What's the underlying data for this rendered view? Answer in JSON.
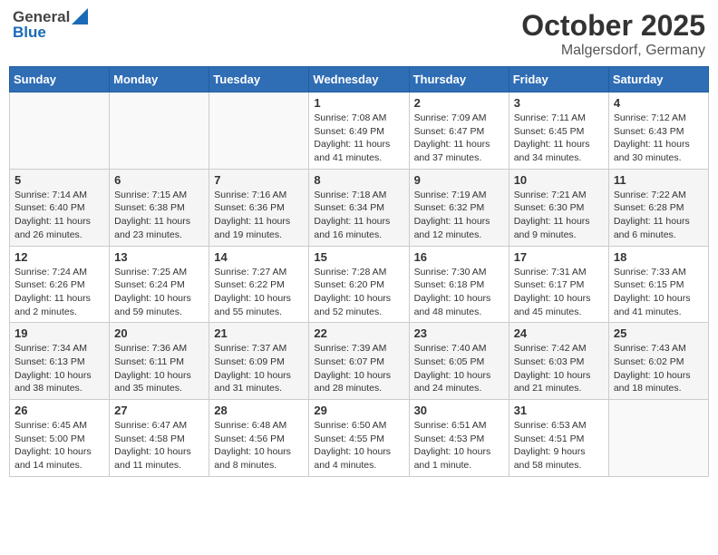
{
  "header": {
    "logo": {
      "general": "General",
      "blue": "Blue"
    },
    "month": "October 2025",
    "location": "Malgersdorf, Germany"
  },
  "weekdays": [
    "Sunday",
    "Monday",
    "Tuesday",
    "Wednesday",
    "Thursday",
    "Friday",
    "Saturday"
  ],
  "weeks": [
    [
      {
        "day": "",
        "sunrise": "",
        "sunset": "",
        "daylight": ""
      },
      {
        "day": "",
        "sunrise": "",
        "sunset": "",
        "daylight": ""
      },
      {
        "day": "",
        "sunrise": "",
        "sunset": "",
        "daylight": ""
      },
      {
        "day": "1",
        "sunrise": "Sunrise: 7:08 AM",
        "sunset": "Sunset: 6:49 PM",
        "daylight": "Daylight: 11 hours and 41 minutes."
      },
      {
        "day": "2",
        "sunrise": "Sunrise: 7:09 AM",
        "sunset": "Sunset: 6:47 PM",
        "daylight": "Daylight: 11 hours and 37 minutes."
      },
      {
        "day": "3",
        "sunrise": "Sunrise: 7:11 AM",
        "sunset": "Sunset: 6:45 PM",
        "daylight": "Daylight: 11 hours and 34 minutes."
      },
      {
        "day": "4",
        "sunrise": "Sunrise: 7:12 AM",
        "sunset": "Sunset: 6:43 PM",
        "daylight": "Daylight: 11 hours and 30 minutes."
      }
    ],
    [
      {
        "day": "5",
        "sunrise": "Sunrise: 7:14 AM",
        "sunset": "Sunset: 6:40 PM",
        "daylight": "Daylight: 11 hours and 26 minutes."
      },
      {
        "day": "6",
        "sunrise": "Sunrise: 7:15 AM",
        "sunset": "Sunset: 6:38 PM",
        "daylight": "Daylight: 11 hours and 23 minutes."
      },
      {
        "day": "7",
        "sunrise": "Sunrise: 7:16 AM",
        "sunset": "Sunset: 6:36 PM",
        "daylight": "Daylight: 11 hours and 19 minutes."
      },
      {
        "day": "8",
        "sunrise": "Sunrise: 7:18 AM",
        "sunset": "Sunset: 6:34 PM",
        "daylight": "Daylight: 11 hours and 16 minutes."
      },
      {
        "day": "9",
        "sunrise": "Sunrise: 7:19 AM",
        "sunset": "Sunset: 6:32 PM",
        "daylight": "Daylight: 11 hours and 12 minutes."
      },
      {
        "day": "10",
        "sunrise": "Sunrise: 7:21 AM",
        "sunset": "Sunset: 6:30 PM",
        "daylight": "Daylight: 11 hours and 9 minutes."
      },
      {
        "day": "11",
        "sunrise": "Sunrise: 7:22 AM",
        "sunset": "Sunset: 6:28 PM",
        "daylight": "Daylight: 11 hours and 6 minutes."
      }
    ],
    [
      {
        "day": "12",
        "sunrise": "Sunrise: 7:24 AM",
        "sunset": "Sunset: 6:26 PM",
        "daylight": "Daylight: 11 hours and 2 minutes."
      },
      {
        "day": "13",
        "sunrise": "Sunrise: 7:25 AM",
        "sunset": "Sunset: 6:24 PM",
        "daylight": "Daylight: 10 hours and 59 minutes."
      },
      {
        "day": "14",
        "sunrise": "Sunrise: 7:27 AM",
        "sunset": "Sunset: 6:22 PM",
        "daylight": "Daylight: 10 hours and 55 minutes."
      },
      {
        "day": "15",
        "sunrise": "Sunrise: 7:28 AM",
        "sunset": "Sunset: 6:20 PM",
        "daylight": "Daylight: 10 hours and 52 minutes."
      },
      {
        "day": "16",
        "sunrise": "Sunrise: 7:30 AM",
        "sunset": "Sunset: 6:18 PM",
        "daylight": "Daylight: 10 hours and 48 minutes."
      },
      {
        "day": "17",
        "sunrise": "Sunrise: 7:31 AM",
        "sunset": "Sunset: 6:17 PM",
        "daylight": "Daylight: 10 hours and 45 minutes."
      },
      {
        "day": "18",
        "sunrise": "Sunrise: 7:33 AM",
        "sunset": "Sunset: 6:15 PM",
        "daylight": "Daylight: 10 hours and 41 minutes."
      }
    ],
    [
      {
        "day": "19",
        "sunrise": "Sunrise: 7:34 AM",
        "sunset": "Sunset: 6:13 PM",
        "daylight": "Daylight: 10 hours and 38 minutes."
      },
      {
        "day": "20",
        "sunrise": "Sunrise: 7:36 AM",
        "sunset": "Sunset: 6:11 PM",
        "daylight": "Daylight: 10 hours and 35 minutes."
      },
      {
        "day": "21",
        "sunrise": "Sunrise: 7:37 AM",
        "sunset": "Sunset: 6:09 PM",
        "daylight": "Daylight: 10 hours and 31 minutes."
      },
      {
        "day": "22",
        "sunrise": "Sunrise: 7:39 AM",
        "sunset": "Sunset: 6:07 PM",
        "daylight": "Daylight: 10 hours and 28 minutes."
      },
      {
        "day": "23",
        "sunrise": "Sunrise: 7:40 AM",
        "sunset": "Sunset: 6:05 PM",
        "daylight": "Daylight: 10 hours and 24 minutes."
      },
      {
        "day": "24",
        "sunrise": "Sunrise: 7:42 AM",
        "sunset": "Sunset: 6:03 PM",
        "daylight": "Daylight: 10 hours and 21 minutes."
      },
      {
        "day": "25",
        "sunrise": "Sunrise: 7:43 AM",
        "sunset": "Sunset: 6:02 PM",
        "daylight": "Daylight: 10 hours and 18 minutes."
      }
    ],
    [
      {
        "day": "26",
        "sunrise": "Sunrise: 6:45 AM",
        "sunset": "Sunset: 5:00 PM",
        "daylight": "Daylight: 10 hours and 14 minutes."
      },
      {
        "day": "27",
        "sunrise": "Sunrise: 6:47 AM",
        "sunset": "Sunset: 4:58 PM",
        "daylight": "Daylight: 10 hours and 11 minutes."
      },
      {
        "day": "28",
        "sunrise": "Sunrise: 6:48 AM",
        "sunset": "Sunset: 4:56 PM",
        "daylight": "Daylight: 10 hours and 8 minutes."
      },
      {
        "day": "29",
        "sunrise": "Sunrise: 6:50 AM",
        "sunset": "Sunset: 4:55 PM",
        "daylight": "Daylight: 10 hours and 4 minutes."
      },
      {
        "day": "30",
        "sunrise": "Sunrise: 6:51 AM",
        "sunset": "Sunset: 4:53 PM",
        "daylight": "Daylight: 10 hours and 1 minute."
      },
      {
        "day": "31",
        "sunrise": "Sunrise: 6:53 AM",
        "sunset": "Sunset: 4:51 PM",
        "daylight": "Daylight: 9 hours and 58 minutes."
      },
      {
        "day": "",
        "sunrise": "",
        "sunset": "",
        "daylight": ""
      }
    ]
  ]
}
